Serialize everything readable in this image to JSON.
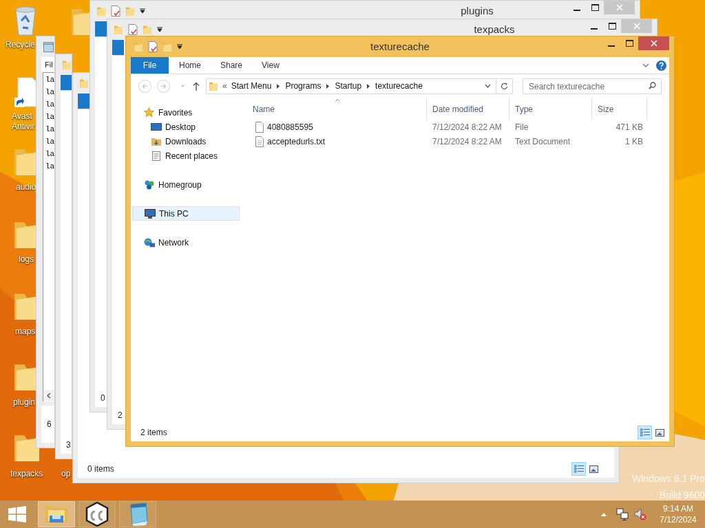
{
  "desktop_icons": [
    {
      "kind": "recycle",
      "lines": [
        "Recycle"
      ]
    },
    {
      "kind": "folder"
    },
    {
      "kind": "shortcut",
      "lines": [
        "Avast",
        "Antivir"
      ]
    },
    {
      "kind": "folder",
      "lines": [
        "audio"
      ]
    },
    {
      "kind": "folder",
      "lines": [
        "logs"
      ]
    },
    {
      "kind": "folder",
      "lines": [
        "maps"
      ]
    },
    {
      "kind": "folder",
      "lines": [
        "plugin"
      ]
    },
    {
      "kind": "folder",
      "lines": [
        "texpacks"
      ]
    },
    {
      "lines": [
        "op"
      ]
    }
  ],
  "windows": [
    {
      "kind": "notepad",
      "menu": "Fil",
      "lines": [
        "la",
        "la",
        "la",
        "la",
        "la",
        "la",
        "la",
        "la"
      ],
      "status": "6"
    },
    {
      "kind": "explorer",
      "status": "3"
    },
    {
      "kind": "explorer",
      "status": "0 items",
      "view_buttons": [
        {
          "kind": "details",
          "selected": true
        },
        {
          "kind": "large_icons",
          "selected": false
        }
      ]
    },
    {
      "kind": "explorer",
      "title": "plugins",
      "status": "0"
    },
    {
      "kind": "explorer",
      "title": "texpacks",
      "status": "2"
    }
  ],
  "active_window": {
    "title": "texturecache",
    "ribbon_tabs": [
      {
        "label": "File",
        "kind": "file"
      },
      {
        "label": "Home",
        "kind": "tab"
      },
      {
        "label": "Share",
        "kind": "tab"
      },
      {
        "label": "View",
        "kind": "tab"
      }
    ],
    "address": {
      "overflow": "«",
      "crumbs": [
        "Start Menu",
        "Programs",
        "Startup",
        "texturecache"
      ]
    },
    "search": {
      "placeholder": "Search texturecache"
    },
    "nav": [
      {
        "label": "Favorites",
        "kind": "favorites",
        "selected": false,
        "children": [
          {
            "label": "Desktop",
            "kind": "desktop",
            "selected": false
          },
          {
            "label": "Downloads",
            "kind": "downloads",
            "selected": false
          },
          {
            "label": "Recent places",
            "kind": "recent",
            "selected": false
          }
        ]
      },
      {
        "label": "Homegroup",
        "kind": "homegroup",
        "selected": false
      },
      {
        "label": "This PC",
        "kind": "pc",
        "selected": true
      },
      {
        "label": "Network",
        "kind": "network",
        "selected": false
      }
    ],
    "columns": [
      {
        "label": "Name",
        "sorted": true
      },
      {
        "label": "Date modified",
        "sorted": false
      },
      {
        "label": "Type",
        "sorted": false
      },
      {
        "label": "Size",
        "sorted": false
      }
    ],
    "rows": [
      {
        "kind": "file",
        "name": "4080885595",
        "date": "7/12/2024 8:22 AM",
        "type": "File",
        "size": "471 KB"
      },
      {
        "kind": "text",
        "name": "acceptedurls.txt",
        "date": "7/12/2024 8:22 AM",
        "type": "Text Document",
        "size": "1 KB"
      }
    ],
    "status": "2 items",
    "view_buttons": [
      {
        "kind": "details",
        "selected": true
      },
      {
        "kind": "large_icons",
        "selected": false
      }
    ]
  },
  "os_edition": [
    "Windows 8.1 Pro",
    "Build 9600"
  ],
  "taskbar": {
    "apps": [
      {
        "kind": "explorer",
        "selected": true
      },
      {
        "kind": "cube",
        "selected": false
      },
      {
        "kind": "notepad",
        "selected": false
      }
    ],
    "time": "9:14 AM",
    "date": "7/12/2024"
  }
}
